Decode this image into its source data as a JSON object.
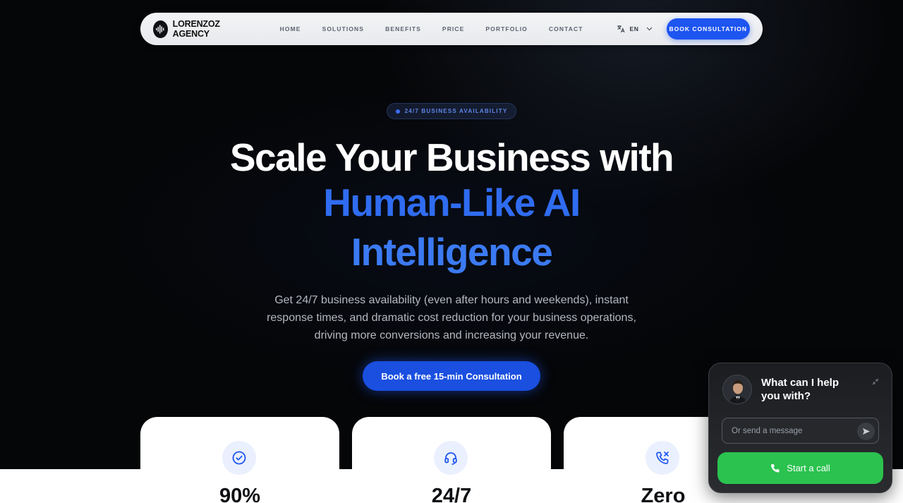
{
  "nav": {
    "brand": "LORENZOZ AGENCY",
    "links": [
      "HOME",
      "SOLUTIONS",
      "BENEFITS",
      "PRICE",
      "PORTFOLIO",
      "CONTACT"
    ],
    "language": "EN",
    "cta": "BOOK CONSULTATION"
  },
  "hero": {
    "badge": "24/7 BUSINESS AVAILABILITY",
    "title_line1": "Scale Your Business with",
    "title_line2": "Human-Like AI",
    "title_line3": "Intelligence",
    "subtitle": "Get 24/7 business availability (even after hours and weekends), instant response times, and dramatic cost reduction for your business operations, driving more conversions and increasing your revenue.",
    "cta": "Book a free 15-min Consultation"
  },
  "stats": [
    {
      "icon": "check-circle-icon",
      "value": "90%"
    },
    {
      "icon": "headset-icon",
      "value": "24/7"
    },
    {
      "icon": "phone-missed-icon",
      "value": "Zero"
    }
  ],
  "chat": {
    "title": "What can I help you with?",
    "input_placeholder": "Or send a message",
    "call_label": "Start a call"
  },
  "colors": {
    "accent": "#1d55f0",
    "call_green": "#2bc24f",
    "title_blue": "#2f6cf0"
  }
}
